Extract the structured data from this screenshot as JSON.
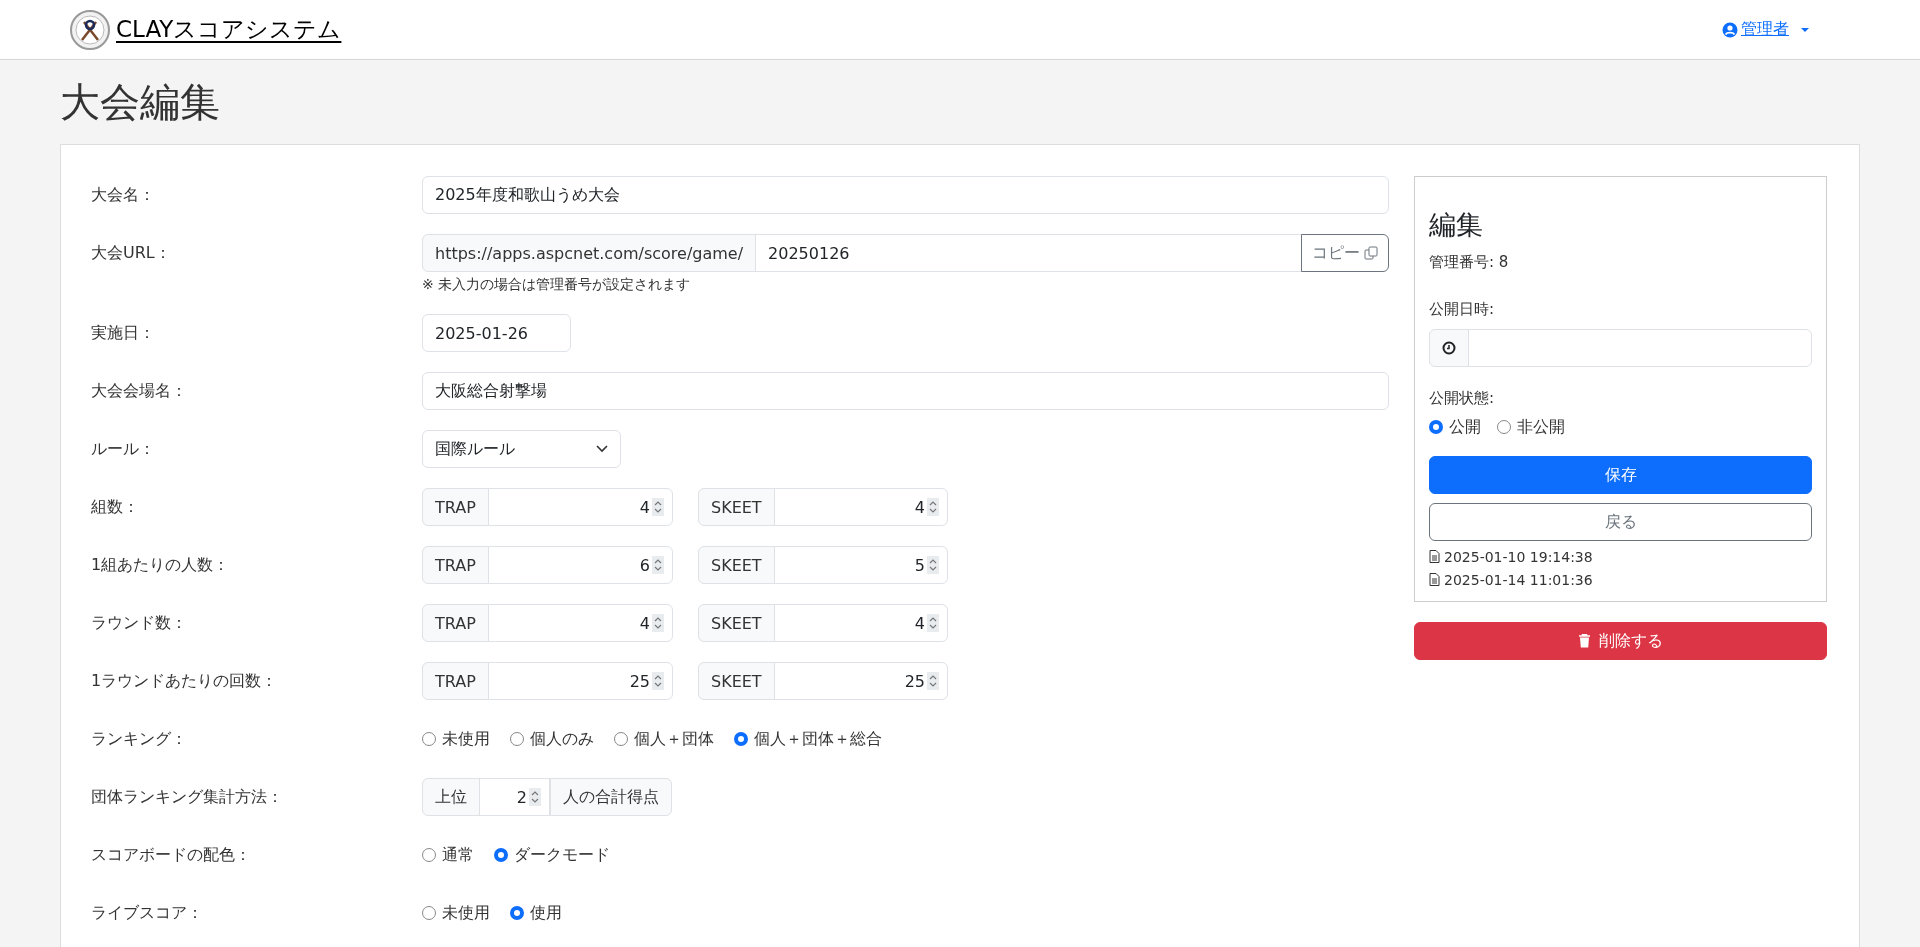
{
  "header": {
    "brand": "CLAYスコアシステム",
    "user": "管理者"
  },
  "page_title": "大会編集",
  "form": {
    "rows": [
      {
        "kind": "text",
        "label": "大会名：",
        "value": "2025年度和歌山うめ大会"
      },
      {
        "kind": "url",
        "label": "大会URL：",
        "prefix": "https://apps.aspcnet.com/score/game/",
        "value": "20250126",
        "button": "コピー",
        "note": "※ 未入力の場合は管理番号が設定されます"
      },
      {
        "kind": "date",
        "label": "実施日：",
        "value": "2025-01-26"
      },
      {
        "kind": "text",
        "label": "大会会場名：",
        "value": "大阪総合射撃場"
      },
      {
        "kind": "select",
        "label": "ルール：",
        "value": "国際ルール"
      },
      {
        "kind": "pair",
        "label": "組数：",
        "fields": [
          {
            "prefix": "TRAP",
            "value": "4"
          },
          {
            "prefix": "SKEET",
            "value": "4"
          }
        ]
      },
      {
        "kind": "pair",
        "label": "1組あたりの人数：",
        "fields": [
          {
            "prefix": "TRAP",
            "value": "6"
          },
          {
            "prefix": "SKEET",
            "value": "5"
          }
        ]
      },
      {
        "kind": "pair",
        "label": "ラウンド数：",
        "fields": [
          {
            "prefix": "TRAP",
            "value": "4"
          },
          {
            "prefix": "SKEET",
            "value": "4"
          }
        ]
      },
      {
        "kind": "pair",
        "label": "1ラウンドあたりの回数：",
        "fields": [
          {
            "prefix": "TRAP",
            "value": "25"
          },
          {
            "prefix": "SKEET",
            "value": "25"
          }
        ]
      },
      {
        "kind": "radio",
        "label": "ランキング：",
        "options": [
          {
            "label": "未使用",
            "selected": false
          },
          {
            "label": "個人のみ",
            "selected": false
          },
          {
            "label": "個人＋団体",
            "selected": false
          },
          {
            "label": "個人＋団体＋総合",
            "selected": true
          }
        ]
      },
      {
        "kind": "team",
        "label": "団体ランキング集計方法：",
        "before": "上位",
        "value": "2",
        "after": "人の合計得点"
      },
      {
        "kind": "radio",
        "label": "スコアボードの配色：",
        "options": [
          {
            "label": "通常",
            "selected": false
          },
          {
            "label": "ダークモード",
            "selected": true
          }
        ]
      },
      {
        "kind": "radio",
        "label": "ライブスコア：",
        "options": [
          {
            "label": "未使用",
            "selected": false
          },
          {
            "label": "使用",
            "selected": true
          }
        ]
      }
    ]
  },
  "sidebar": {
    "title": "編集",
    "id_line": "管理番号: 8",
    "publish_label": "公開日時:",
    "status_label": "公開状態:",
    "status_options": [
      {
        "label": "公開",
        "selected": true
      },
      {
        "label": "非公開",
        "selected": false
      }
    ],
    "save": "保存",
    "back": "戻る",
    "history": [
      "2025-01-10 19:14:38",
      "2025-01-14 11:01:36"
    ],
    "delete": "削除する"
  }
}
